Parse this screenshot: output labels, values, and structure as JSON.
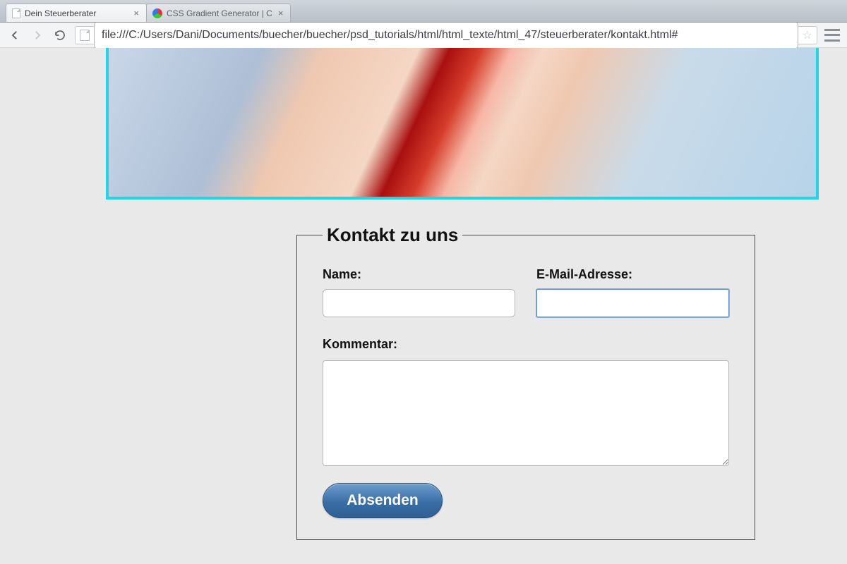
{
  "browser": {
    "tabs": [
      {
        "title": "Dein Steuerberater",
        "favicon": "page"
      },
      {
        "title": "CSS Gradient Generator | C",
        "favicon": "wheel"
      }
    ],
    "url": "file:///C:/Users/Dani/Documents/buecher/buecher/psd_tutorials/html/html_texte/html_47/steuerberater/kontakt.html#"
  },
  "form": {
    "legend": "Kontakt zu uns",
    "name_label": "Name:",
    "email_label": "E-Mail-Adresse:",
    "comment_label": "Kommentar:",
    "submit_label": "Absenden",
    "name_value": "",
    "email_value": "",
    "comment_value": ""
  }
}
